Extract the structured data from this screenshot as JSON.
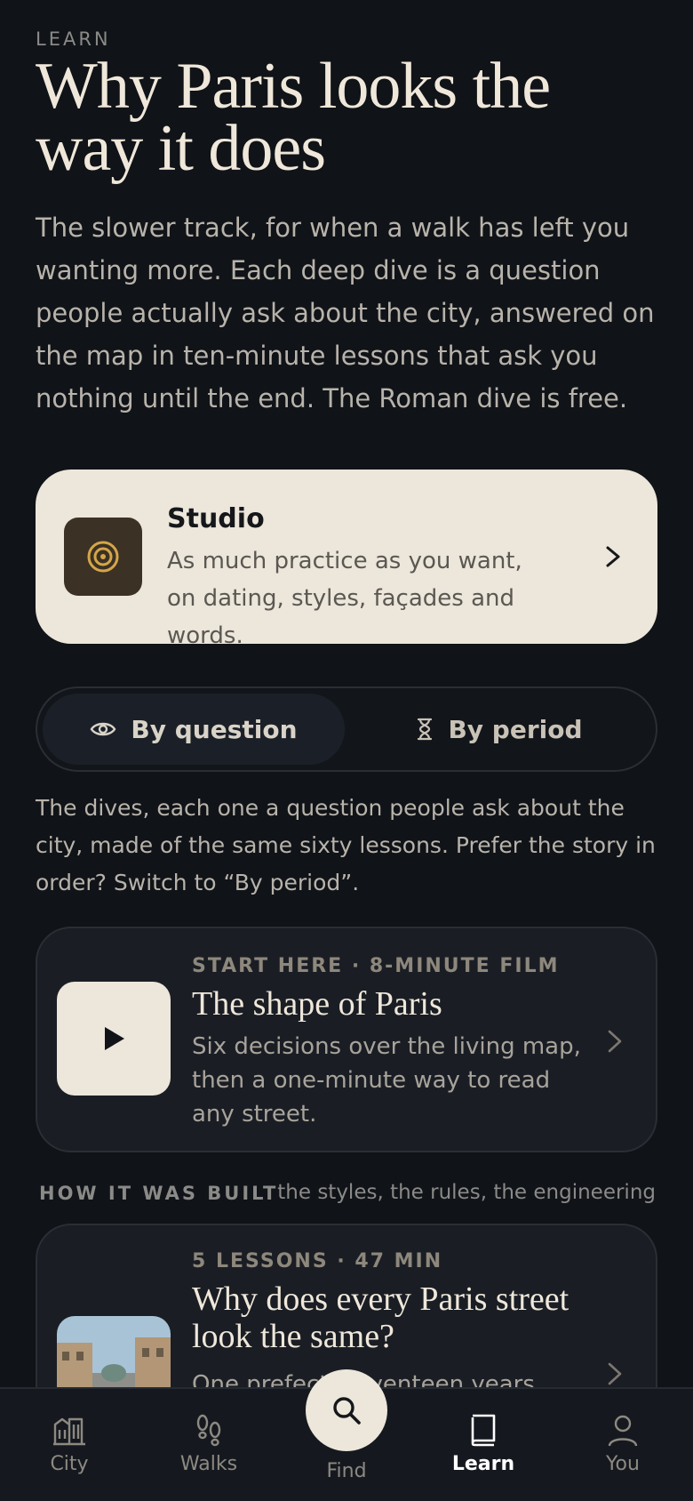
{
  "header": {
    "eyebrow": "LEARN",
    "title": "Why Paris looks the way it does",
    "intro": "The slower track, for when a walk has left you wanting more. Each deep dive is a question people actually ask about the city, answered on the map in ten-minute lessons that ask you nothing until the end. The Roman dive is free."
  },
  "studio": {
    "icon": "target-icon",
    "title": "Studio",
    "description": "As much practice as you want, on dating, styles, façades and words."
  },
  "segmented": {
    "options": [
      {
        "label": "By question",
        "icon": "eye-icon",
        "selected": true
      },
      {
        "label": "By period",
        "icon": "hourglass-icon",
        "selected": false
      }
    ],
    "note": "The dives, each one a question people ask about the city, made of the same sixty lessons. Prefer the story in order? Switch to “By period”."
  },
  "film_card": {
    "meta": "START HERE · 8-MINUTE FILM",
    "title": "The shape of Paris",
    "description": "Six decisions over the living map, then a one-minute way to read any street."
  },
  "section": {
    "heading": "HOW IT WAS BUILT",
    "subheading": "the styles, the rules, the engineering"
  },
  "lesson_card": {
    "meta": "5 LESSONS · 47 MIN",
    "title": "Why does every Paris street look the same?",
    "description": "One prefect, seventeen years, and"
  },
  "tabbar": {
    "tabs": [
      {
        "label": "City",
        "icon": "buildings-icon"
      },
      {
        "label": "Walks",
        "icon": "footprints-icon"
      },
      {
        "label": "Find",
        "icon": "search-icon"
      },
      {
        "label": "Learn",
        "icon": "book-icon",
        "active": true
      },
      {
        "label": "You",
        "icon": "person-icon"
      }
    ]
  },
  "colors": {
    "background": "#101317",
    "cream": "#ece6db",
    "card": "#1a1e24",
    "accent_gold": "#d4a64a"
  }
}
